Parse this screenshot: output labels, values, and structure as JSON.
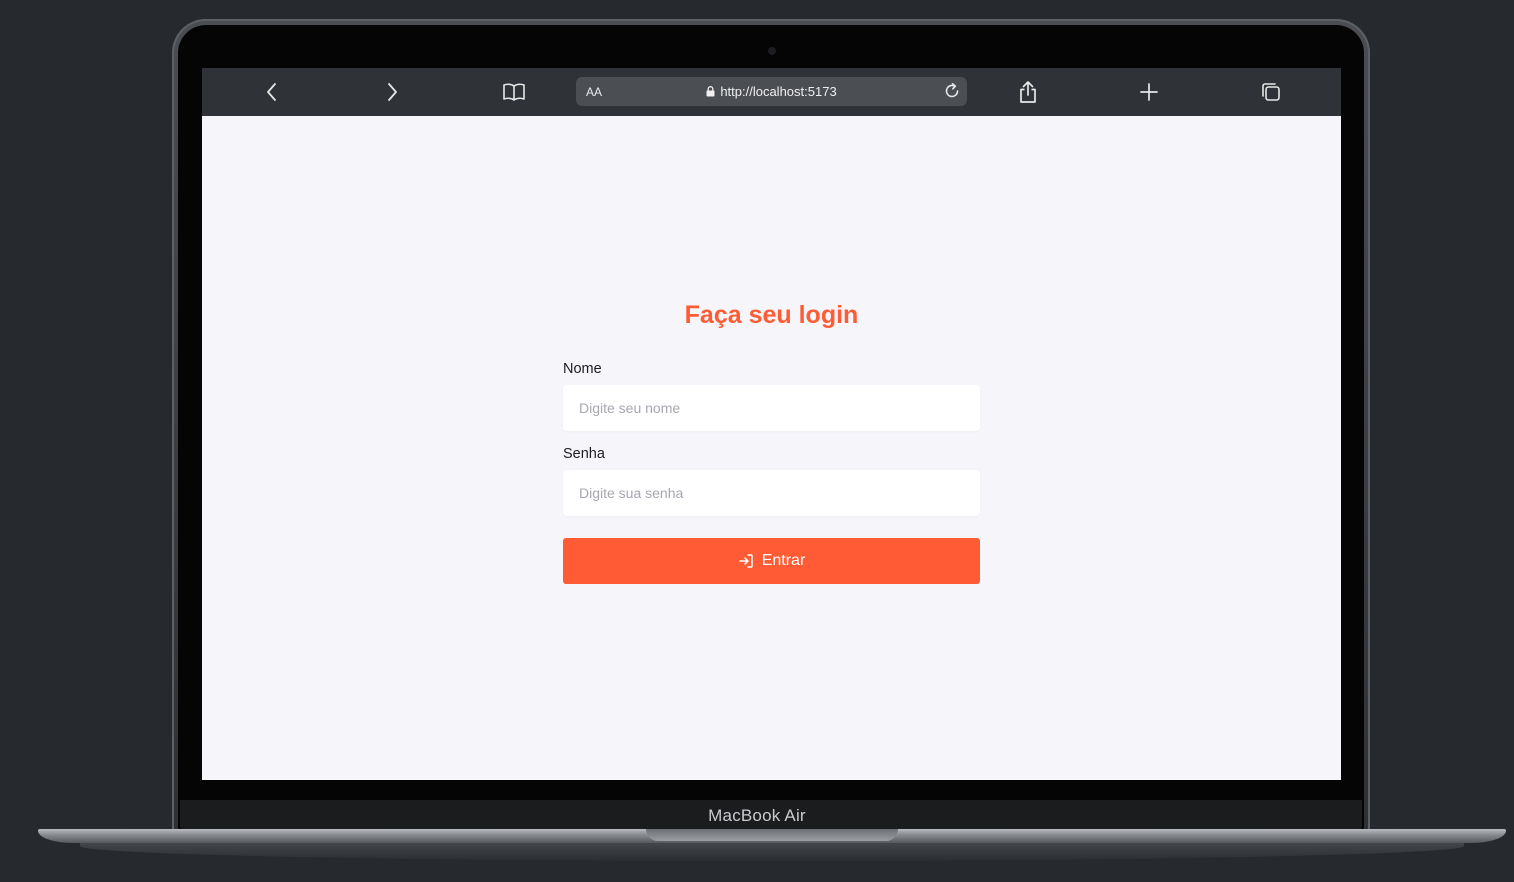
{
  "device": {
    "label": "MacBook Air"
  },
  "browser": {
    "text_size_label": "AA",
    "url": "http://localhost:5173",
    "icons": {
      "back": "chevron-left-icon",
      "forward": "chevron-right-icon",
      "bookmarks": "book-icon",
      "secure": "lock-icon",
      "reload": "reload-icon",
      "share": "share-icon",
      "new_tab": "plus-icon",
      "tabs": "tabs-icon"
    }
  },
  "login": {
    "title": "Faça seu login",
    "name_label": "Nome",
    "name_placeholder": "Digite seu nome",
    "name_value": "",
    "password_label": "Senha",
    "password_placeholder": "Digite sua senha",
    "password_value": "",
    "submit_label": "Entrar",
    "submit_icon": "login-icon"
  },
  "colors": {
    "accent": "#ff5c35",
    "page_background": "#f5f5fa",
    "toolbar_background": "#2f3236"
  }
}
